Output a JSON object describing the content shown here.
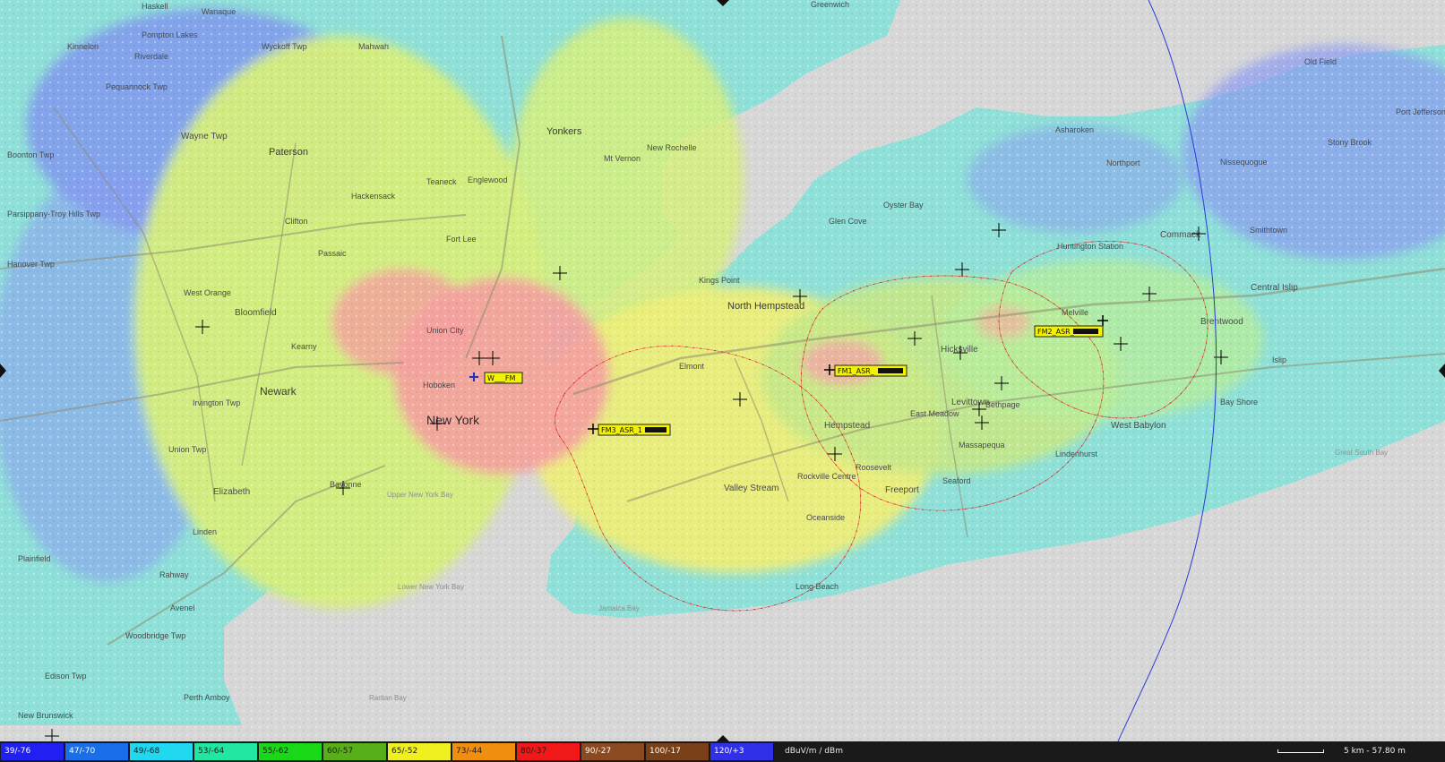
{
  "map": {
    "colors": {
      "water": "#d7d7d7",
      "land_base": "#9fe4e0",
      "crosshair": "#000000",
      "contour": "#e02020",
      "range_ring": "#2a3ad8",
      "tx_label_bg": "#f3f300"
    },
    "labels": [
      {
        "text": "Haskell"
      },
      {
        "text": "Wanaque"
      },
      {
        "text": "Pompton Lakes"
      },
      {
        "text": "Kinnelon"
      },
      {
        "text": "Riverdale"
      },
      {
        "text": "Wyckoff Twp"
      },
      {
        "text": "Mahwah"
      },
      {
        "text": "Pequannock Twp"
      },
      {
        "text": "Wayne Twp"
      },
      {
        "text": "Paterson"
      },
      {
        "text": "Boonton Twp"
      },
      {
        "text": "Parsippany-Troy Hills Twp"
      },
      {
        "text": "Hanover Twp"
      },
      {
        "text": "West Orange"
      },
      {
        "text": "Bloomfield"
      },
      {
        "text": "Newark"
      },
      {
        "text": "Kearny"
      },
      {
        "text": "Irvington Twp"
      },
      {
        "text": "Union Twp"
      },
      {
        "text": "Elizabeth"
      },
      {
        "text": "Linden"
      },
      {
        "text": "Plainfield"
      },
      {
        "text": "Rahway"
      },
      {
        "text": "Avenel"
      },
      {
        "text": "Woodbridge Twp"
      },
      {
        "text": "Perth Amboy"
      },
      {
        "text": "Edison Twp"
      },
      {
        "text": "New Brunswick"
      },
      {
        "text": "Clifton"
      },
      {
        "text": "Passaic"
      },
      {
        "text": "Hackensack"
      },
      {
        "text": "Teaneck"
      },
      {
        "text": "Englewood"
      },
      {
        "text": "Fort Lee"
      },
      {
        "text": "Union City"
      },
      {
        "text": "Hoboken"
      },
      {
        "text": "Bayonne"
      },
      {
        "text": "Yonkers"
      },
      {
        "text": "Mt Vernon"
      },
      {
        "text": "New Rochelle"
      },
      {
        "text": "Greenwich"
      },
      {
        "text": "North Hempstead"
      },
      {
        "text": "Hempstead"
      },
      {
        "text": "Valley Stream"
      },
      {
        "text": "Oceanside"
      },
      {
        "text": "Long Beach"
      },
      {
        "text": "Freeport"
      },
      {
        "text": "Levittown"
      },
      {
        "text": "Hicksville"
      },
      {
        "text": "Bethpage"
      },
      {
        "text": "Massapequa"
      },
      {
        "text": "East Meadow"
      },
      {
        "text": "Huntington Station"
      },
      {
        "text": "Commack"
      },
      {
        "text": "Brentwood"
      },
      {
        "text": "Central Islip"
      },
      {
        "text": "West Babylon"
      },
      {
        "text": "Bay Shore"
      },
      {
        "text": "Islip"
      },
      {
        "text": "Melville"
      },
      {
        "text": "Oyster Bay"
      },
      {
        "text": "Northport"
      },
      {
        "text": "Asharoken"
      },
      {
        "text": "Nissequogue"
      },
      {
        "text": "Smithtown"
      },
      {
        "text": "Kings Point"
      },
      {
        "text": "Glen Cove"
      },
      {
        "text": "Elmont"
      },
      {
        "text": "Rockville Centre"
      },
      {
        "text": "Roosevelt"
      },
      {
        "text": "Seaford"
      },
      {
        "text": "Old Field"
      },
      {
        "text": "Port Jefferson"
      },
      {
        "text": "Stony Brook"
      },
      {
        "text": "Lindenhurst"
      },
      {
        "text": "Great South Bay"
      },
      {
        "text": "Raritan Bay"
      },
      {
        "text": "Upper New York Bay"
      },
      {
        "text": "Lower New York Bay"
      },
      {
        "text": "Jamaica Bay"
      }
    ],
    "city_label": "New York",
    "transmitters": [
      {
        "label": "W___FM",
        "marker_color": "#2030c0"
      },
      {
        "label": "FM3_ASR_1",
        "marker_color": "#000000"
      },
      {
        "label": "FM1_ASR_",
        "marker_color": "#000000"
      },
      {
        "label": "FM2_ASR_",
        "marker_color": "#000000"
      }
    ]
  },
  "legend": {
    "entries": [
      {
        "label": "39/-76",
        "color": "#2020f0",
        "text_color": "#ffffff"
      },
      {
        "label": "47/-70",
        "color": "#1a6fe8",
        "text_color": "#ffffff"
      },
      {
        "label": "49/-68",
        "color": "#20d8f0",
        "text_color": "#1a1a1a"
      },
      {
        "label": "53/-64",
        "color": "#20e8a0",
        "text_color": "#1a1a1a"
      },
      {
        "label": "55/-62",
        "color": "#18d818",
        "text_color": "#1a1a1a"
      },
      {
        "label": "60/-57",
        "color": "#58b018",
        "text_color": "#1a1a1a"
      },
      {
        "label": "65/-52",
        "color": "#f0f020",
        "text_color": "#1a1a1a"
      },
      {
        "label": "73/-44",
        "color": "#f08e10",
        "text_color": "#1a1a1a"
      },
      {
        "label": "80/-37",
        "color": "#f01818",
        "text_color": "#1a1a1a"
      },
      {
        "label": "90/-27",
        "color": "#8b4a20",
        "text_color": "#ffffff"
      },
      {
        "label": "100/-17",
        "color": "#7a4018",
        "text_color": "#ffffff"
      },
      {
        "label": "120/+3",
        "color": "#3030e8",
        "text_color": "#ffffff"
      }
    ],
    "unit_label": "dBuV/m / dBm"
  },
  "scale": {
    "label": "5 km - 57.80 m"
  }
}
